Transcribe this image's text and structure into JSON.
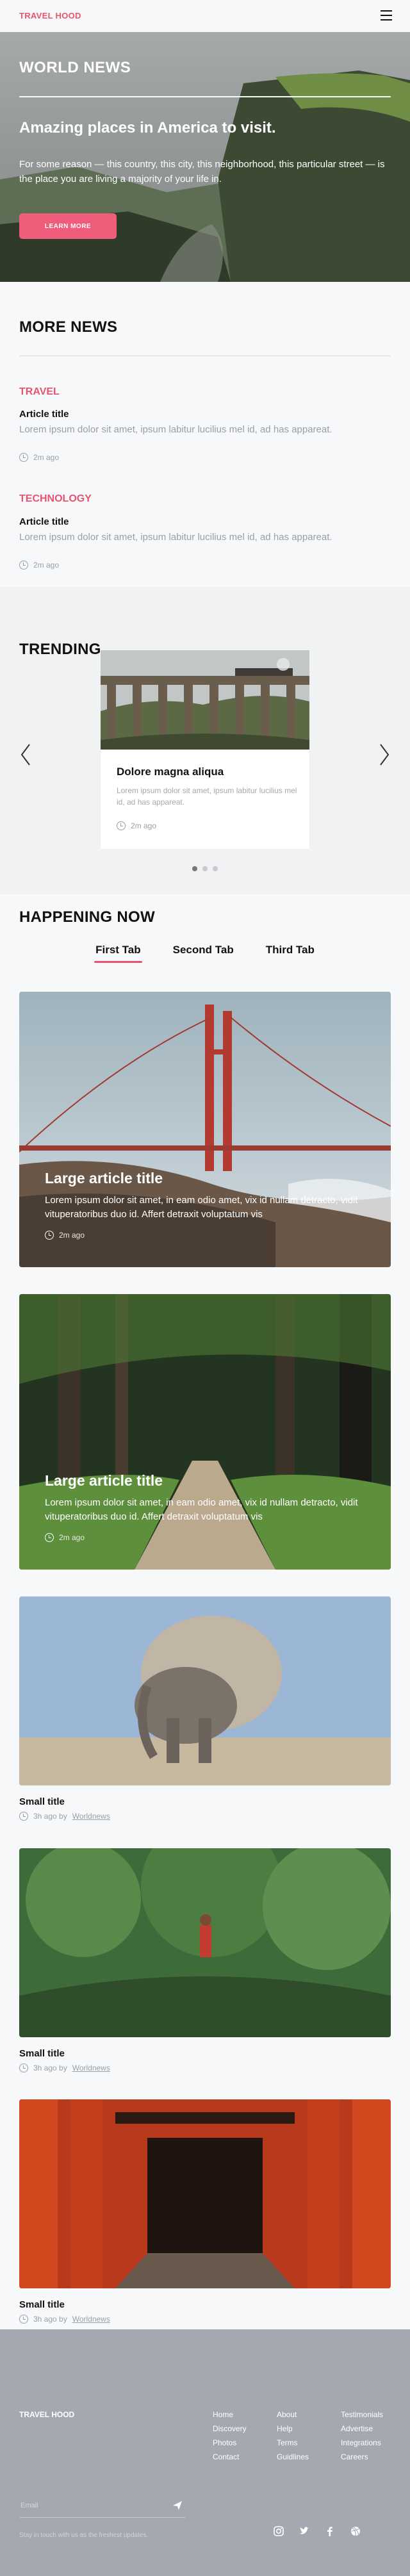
{
  "header": {
    "brand": "TRAVEL HOOD",
    "menu_icon": "hamburger-menu-icon"
  },
  "hero": {
    "title": "WORLD NEWS",
    "headline": "Amazing places in America to visit.",
    "text": "For some reason — this country, this city, this neighborhood, this particular street — is the place you are living a majority of your life in.",
    "button": "LEARN MORE"
  },
  "more_news": {
    "title": "MORE NEWS",
    "items": [
      {
        "category": "TRAVEL",
        "title": "Article title",
        "text": "Lorem ipsum dolor sit amet, ipsum labitur lucilius mel id, ad has appareat.",
        "time": "2m ago"
      },
      {
        "category": "TECHNOLOGY",
        "title": "Article title",
        "text": "Lorem ipsum dolor sit amet, ipsum labitur lucilius mel id, ad has appareat.",
        "time": "2m ago"
      }
    ]
  },
  "trending": {
    "title": "TRENDING",
    "card": {
      "title": "Dolore magna aliqua",
      "text": "Lorem ipsum dolor sit amet, ipsum labitur lucilius mel id, ad has appareat.",
      "time": "2m ago"
    },
    "slides": 3,
    "active_slide": 1
  },
  "happening": {
    "title": "HAPPENING NOW",
    "tabs": [
      "First Tab",
      "Second Tab",
      "Third Tab"
    ],
    "active_tab": "First Tab",
    "large_cards": [
      {
        "title": "Large article title",
        "text": "Lorem ipsum dolor sit amet, in eam odio amet, vix id nullam detracto, vidit vituperatoribus duo id. Affert detraxit voluptatum vis",
        "time": "2m ago"
      },
      {
        "title": "Large article title",
        "text": "Lorem ipsum dolor sit amet, in eam odio amet, vix id nullam detracto, vidit vituperatoribus duo id. Affert detraxit voluptatum vis",
        "time": "2m ago"
      }
    ],
    "small_cards": [
      {
        "title": "Small title",
        "time": "3h ago by",
        "author": "Worldnews"
      },
      {
        "title": "Small title",
        "time": "3h ago by",
        "author": "Worldnews"
      },
      {
        "title": "Small title",
        "time": "3h ago by",
        "author": "Worldnews"
      }
    ]
  },
  "footer": {
    "brand": "TRAVEL HOOD",
    "columns": [
      [
        "Home",
        "Discovery",
        "Photos",
        "Contact"
      ],
      [
        "About",
        "Help",
        "Terms",
        "Guidlines"
      ],
      [
        "Testimonials",
        "Advertise",
        "Integrations",
        "Careers"
      ]
    ],
    "email_placeholder": "Email",
    "note": "Stay in touch with us as the freshest updates.",
    "social": [
      "instagram-icon",
      "twitter-icon",
      "facebook-icon",
      "dribbble-icon"
    ]
  },
  "colors": {
    "accent": "#e8546f",
    "footer_bg": "#a4a9b1",
    "page_bg": "#f7f8fa"
  }
}
